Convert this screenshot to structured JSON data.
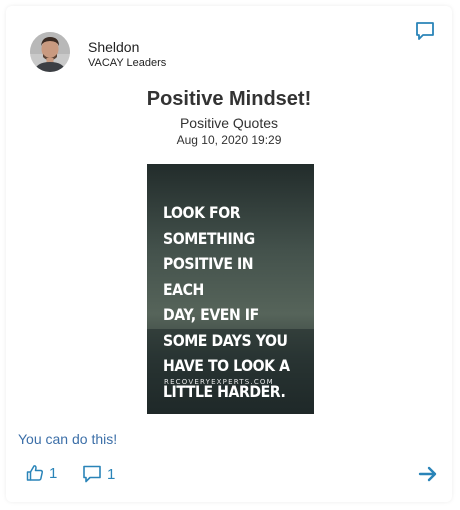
{
  "post": {
    "author_name": "Sheldon",
    "author_group": "VACAY Leaders",
    "title": "Positive Mindset!",
    "category": "Positive Quotes",
    "timestamp": "Aug 10, 2020 19:29",
    "image_quote": "LOOK FOR\nSOMETHING\nPOSITIVE IN EACH\nDAY, EVEN IF\nSOME DAYS YOU\nHAVE TO LOOK A\nLITTLE HARDER.",
    "image_source": "RECOVERYEXPERTS.COM",
    "caption": "You can do this!"
  },
  "actions": {
    "like_count": "1",
    "comment_count": "1"
  },
  "icons": {
    "top": "comment-icon",
    "like": "thumbs-up-icon",
    "comment": "comment-icon",
    "next": "arrow-right-icon"
  },
  "colors": {
    "accent": "#2a84b8",
    "caption": "#3c6fa8",
    "text": "#333333"
  }
}
